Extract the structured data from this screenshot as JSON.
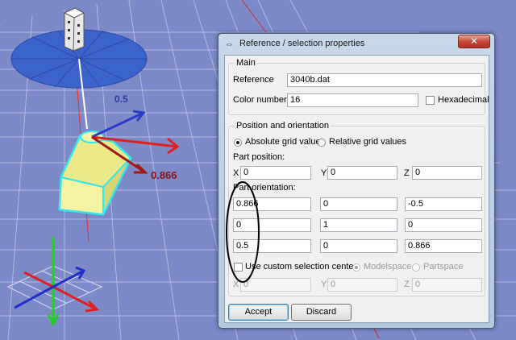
{
  "dialog": {
    "title": "Reference / selection properties",
    "close_label": "✕"
  },
  "main_group": {
    "label": "Main",
    "reference_label": "Reference",
    "reference_value": "3040b.dat",
    "color_label": "Color number",
    "color_value": "16",
    "hex_label": "Hexadecimal",
    "hex_checked": false
  },
  "position_group": {
    "label": "Position and orientation",
    "absolute_label": "Absolute grid values",
    "relative_label": "Relative grid values",
    "grid_mode": "absolute",
    "part_position_label": "Part position:",
    "x_label": "X",
    "x_value": "0",
    "y_label": "Y",
    "y_value": "0",
    "z_label": "Z",
    "z_value": "0",
    "orientation_label": "Part orientation:",
    "matrix": [
      [
        "0.866",
        "0",
        "-0.5"
      ],
      [
        "0",
        "1",
        "0"
      ],
      [
        "0.5",
        "0",
        "0.866"
      ]
    ],
    "custom_center_label": "Use custom selection center:",
    "modelspace_label": "Modelspace",
    "partspace_label": "Partspace",
    "center_x_label": "X",
    "center_x_value": "0",
    "center_y_label": "Y",
    "center_y_value": "0",
    "center_z_label": "Z",
    "center_z_value": "0"
  },
  "buttons": {
    "accept_label": "Accept",
    "discard_label": "Discard"
  },
  "scene": {
    "label_top": "0.5",
    "label_right": "0.866",
    "colors": {
      "background": "#7c8ac8",
      "grid": "#b0b8e0",
      "disc": "#3a6ad8",
      "part": "#f2ee90",
      "part_outline": "#3de8ee",
      "axis_red": "#e02020",
      "axis_blue": "#2030c8",
      "axis_green": "#20d020",
      "annotation_ellipse": "#000000"
    }
  }
}
